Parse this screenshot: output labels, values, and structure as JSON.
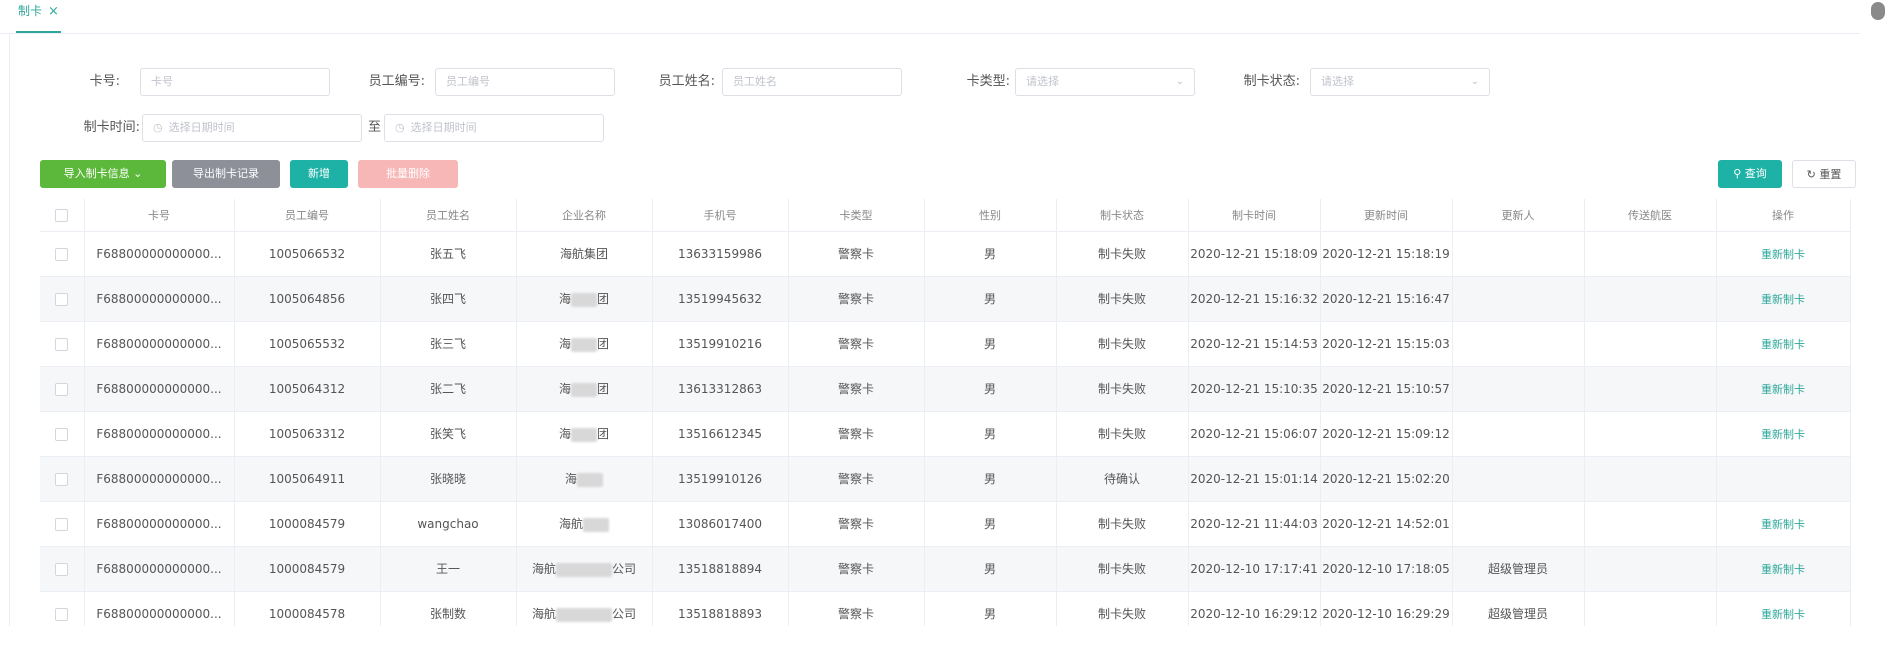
{
  "tab": {
    "label": "制卡",
    "close": "×"
  },
  "filters": {
    "card_no": {
      "label": "卡号:",
      "placeholder": "卡号"
    },
    "emp_no": {
      "label": "员工编号:",
      "placeholder": "员工编号"
    },
    "emp_name": {
      "label": "员工姓名:",
      "placeholder": "员工姓名"
    },
    "card_type": {
      "label": "卡类型:",
      "placeholder": "请选择"
    },
    "status": {
      "label": "制卡状态:",
      "placeholder": "请选择"
    },
    "time": {
      "label": "制卡时间:",
      "start_placeholder": "选择日期时间",
      "separator": "至",
      "end_placeholder": "选择日期时间"
    }
  },
  "toolbar": {
    "import": "导入制卡信息",
    "export": "导出制卡记录",
    "add": "新增",
    "batch_delete": "批量删除",
    "query": "查询",
    "reset": "重置"
  },
  "icons": {
    "chevron": "chevron-down-icon",
    "clock": "clock-icon",
    "search": "search-icon",
    "refresh": "refresh-icon"
  },
  "colors": {
    "accent": "#1eb2a6",
    "green": "#5cb83a",
    "gray": "#8d9099",
    "pink": "#f6b7b6"
  },
  "columns": [
    "卡号",
    "员工编号",
    "员工姓名",
    "企业名称",
    "手机号",
    "卡类型",
    "性别",
    "制卡状态",
    "制卡时间",
    "更新时间",
    "更新人",
    "传送航医",
    "操作"
  ],
  "rows": [
    {
      "card": "F68800000000000...",
      "emp_no": "1005066532",
      "name": "张五飞",
      "company_a": "海航集团",
      "company_b": "",
      "phone": "13633159986",
      "type": "警察卡",
      "gender": "男",
      "status": "制卡失败",
      "made": "2020-12-21 15:18:09",
      "updated": "2020-12-21 15:18:19",
      "updater": "",
      "sent": "",
      "action": "重新制卡"
    },
    {
      "card": "F68800000000000...",
      "emp_no": "1005064856",
      "name": "张四飞",
      "company_a": "海",
      "company_b": "团",
      "phone": "13519945632",
      "type": "警察卡",
      "gender": "男",
      "status": "制卡失败",
      "made": "2020-12-21 15:16:32",
      "updated": "2020-12-21 15:16:47",
      "updater": "",
      "sent": "",
      "action": "重新制卡"
    },
    {
      "card": "F68800000000000...",
      "emp_no": "1005065532",
      "name": "张三飞",
      "company_a": "海",
      "company_b": "团",
      "phone": "13519910216",
      "type": "警察卡",
      "gender": "男",
      "status": "制卡失败",
      "made": "2020-12-21 15:14:53",
      "updated": "2020-12-21 15:15:03",
      "updater": "",
      "sent": "",
      "action": "重新制卡"
    },
    {
      "card": "F68800000000000...",
      "emp_no": "1005064312",
      "name": "张二飞",
      "company_a": "海",
      "company_b": "团",
      "phone": "13613312863",
      "type": "警察卡",
      "gender": "男",
      "status": "制卡失败",
      "made": "2020-12-21 15:10:35",
      "updated": "2020-12-21 15:10:57",
      "updater": "",
      "sent": "",
      "action": "重新制卡"
    },
    {
      "card": "F68800000000000...",
      "emp_no": "1005063312",
      "name": "张笑飞",
      "company_a": "海",
      "company_b": "团",
      "phone": "13516612345",
      "type": "警察卡",
      "gender": "男",
      "status": "制卡失败",
      "made": "2020-12-21 15:06:07",
      "updated": "2020-12-21 15:09:12",
      "updater": "",
      "sent": "",
      "action": "重新制卡"
    },
    {
      "card": "F68800000000000...",
      "emp_no": "1005064911",
      "name": "张晓晓",
      "company_a": "海",
      "company_b": "",
      "phone": "13519910126",
      "type": "警察卡",
      "gender": "男",
      "status": "待确认",
      "made": "2020-12-21 15:01:14",
      "updated": "2020-12-21 15:02:20",
      "updater": "",
      "sent": "",
      "action": ""
    },
    {
      "card": "F68800000000000...",
      "emp_no": "1000084579",
      "name": "wangchao",
      "company_a": "海航",
      "company_b": "",
      "phone": "13086017400",
      "type": "警察卡",
      "gender": "男",
      "status": "制卡失败",
      "made": "2020-12-21 11:44:03",
      "updated": "2020-12-21 14:52:01",
      "updater": "",
      "sent": "",
      "action": "重新制卡"
    },
    {
      "card": "F68800000000000...",
      "emp_no": "1000084579",
      "name": "王一",
      "company_a": "海航",
      "company_b": "公司",
      "phone": "13518818894",
      "type": "警察卡",
      "gender": "男",
      "status": "制卡失败",
      "made": "2020-12-10 17:17:41",
      "updated": "2020-12-10 17:18:05",
      "updater": "超级管理员",
      "sent": "",
      "action": "重新制卡"
    },
    {
      "card": "F68800000000000...",
      "emp_no": "1000084578",
      "name": "张制数",
      "company_a": "海航",
      "company_b": "公司",
      "phone": "13518818893",
      "type": "警察卡",
      "gender": "男",
      "status": "制卡失败",
      "made": "2020-12-10 16:29:12",
      "updated": "2020-12-10 16:29:29",
      "updater": "超级管理员",
      "sent": "",
      "action": "重新制卡"
    }
  ]
}
